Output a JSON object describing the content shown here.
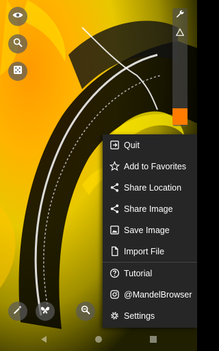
{
  "colors": {
    "accent": "#ff7b00",
    "menu_bg": "#262626",
    "menu_text": "#ffffff"
  },
  "left_toolbar": [
    {
      "icon": "eye-icon"
    },
    {
      "icon": "search-icon"
    },
    {
      "icon": "dice-icon"
    }
  ],
  "right_rail": [
    {
      "icon": "wrench-icon"
    },
    {
      "icon": "triangle-icon"
    }
  ],
  "bottom_toolbar": [
    {
      "icon": "magic-wand-icon"
    },
    {
      "icon": "butterfly-icon"
    },
    {
      "icon": "zoom-out-icon"
    }
  ],
  "menu": {
    "items": [
      {
        "label": "Quit",
        "icon": "exit-icon"
      },
      {
        "label": "Add to Favorites",
        "icon": "star-icon"
      },
      {
        "label": "Share Location",
        "icon": "share-icon"
      },
      {
        "label": "Share Image",
        "icon": "share-icon"
      },
      {
        "label": "Save Image",
        "icon": "image-icon"
      },
      {
        "label": "Import File",
        "icon": "file-icon"
      },
      {
        "label": "Tutorial",
        "icon": "help-icon"
      },
      {
        "label": "@MandelBrowser",
        "icon": "instagram-icon"
      },
      {
        "label": "Settings",
        "icon": "gear-icon"
      }
    ]
  },
  "navbar": [
    {
      "icon": "back-icon"
    },
    {
      "icon": "home-icon"
    },
    {
      "icon": "recents-icon"
    }
  ]
}
